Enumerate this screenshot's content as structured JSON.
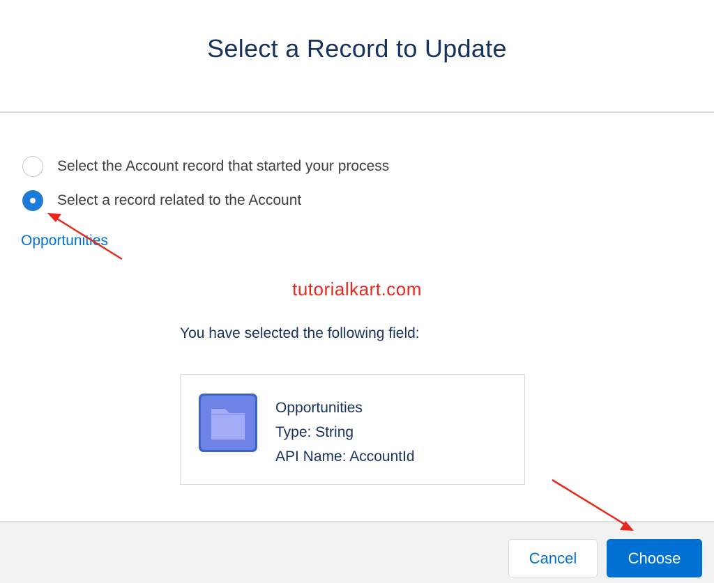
{
  "header": {
    "title": "Select a Record to Update"
  },
  "options": {
    "items": [
      {
        "label": "Select the Account record that started your process",
        "checked": false
      },
      {
        "label": "Select a record related to the Account",
        "checked": true
      }
    ]
  },
  "related": {
    "link_label": "Opportunities"
  },
  "watermark": {
    "text": "tutorialkart.com"
  },
  "selection": {
    "heading": "You have selected the following field:",
    "field": {
      "name": "Opportunities",
      "type": "Type: String",
      "api_name": "API Name: AccountId",
      "icon": "folder-icon"
    }
  },
  "footer": {
    "cancel_label": "Cancel",
    "choose_label": "Choose"
  },
  "colors": {
    "brand": "#0070d2",
    "title": "#16325c",
    "annotation": "#e8281c",
    "folder": "#a3acf6"
  }
}
